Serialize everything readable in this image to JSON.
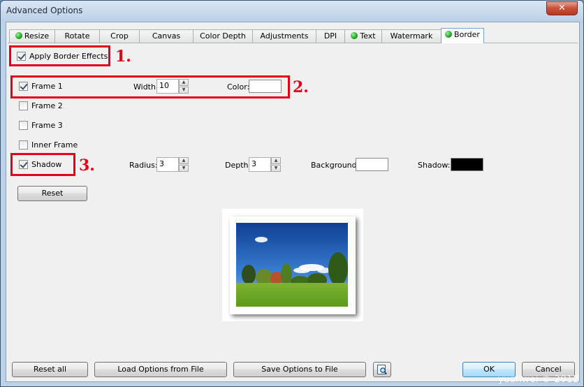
{
  "window": {
    "title": "Advanced Options",
    "close_symbol": "✕"
  },
  "tabs": [
    {
      "label": "Resize",
      "has_dot": true,
      "active": false
    },
    {
      "label": "Rotate",
      "has_dot": false,
      "active": false
    },
    {
      "label": "Crop",
      "has_dot": false,
      "active": false
    },
    {
      "label": "Canvas",
      "has_dot": false,
      "active": false
    },
    {
      "label": "Color Depth",
      "has_dot": false,
      "active": false
    },
    {
      "label": "Adjustments",
      "has_dot": false,
      "active": false
    },
    {
      "label": "DPI",
      "has_dot": false,
      "active": false
    },
    {
      "label": "Text",
      "has_dot": true,
      "active": false
    },
    {
      "label": "Watermark",
      "has_dot": false,
      "active": false
    },
    {
      "label": "Border",
      "has_dot": true,
      "active": true
    }
  ],
  "border": {
    "apply_label": "Apply Border Effects",
    "apply_checked": true,
    "frame1": {
      "label": "Frame 1",
      "checked": true,
      "width_label": "Width:",
      "width_value": "10",
      "color_label": "Color:",
      "color": "#ffffff"
    },
    "frame2": {
      "label": "Frame 2",
      "checked": false
    },
    "frame3": {
      "label": "Frame 3",
      "checked": false
    },
    "inner_frame": {
      "label": "Inner Frame",
      "checked": false
    },
    "shadow": {
      "label": "Shadow",
      "checked": true,
      "radius_label": "Radius:",
      "radius_value": "3",
      "depth_label": "Depth:",
      "depth_value": "3",
      "background_label": "Background:",
      "background_color": "#ffffff",
      "shadow_label": "Shadow:",
      "shadow_color": "#000000"
    },
    "reset_label": "Reset"
  },
  "annotations": {
    "one": "1.",
    "two": "2.",
    "three": "3."
  },
  "footer": {
    "reset_all": "Reset all",
    "load": "Load Options from File",
    "save": "Save Options to File",
    "ok": "OK",
    "cancel": "Cancel"
  },
  "watermark": "yuanwei © 2012",
  "colors": {
    "annotation_red": "#e3001b",
    "status_dot_green": "#1ea31e"
  }
}
